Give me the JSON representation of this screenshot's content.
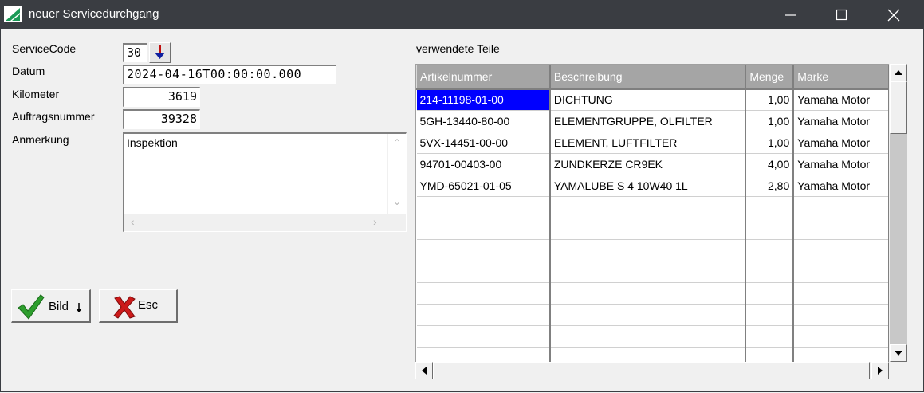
{
  "window": {
    "title": "neuer Servicedurchgang"
  },
  "form": {
    "servicecode_label": "ServiceCode",
    "servicecode_value": "30",
    "datum_label": "Datum",
    "datum_value": "2024-04-16T00:00:00.000",
    "kilometer_label": "Kilometer",
    "kilometer_value": "3619",
    "auftrag_label": "Auftragsnummer",
    "auftrag_value": "39328",
    "anmerkung_label": "Anmerkung",
    "anmerkung_value": "Inspektion"
  },
  "buttons": {
    "bild_label": "Bild",
    "esc_label": "Esc"
  },
  "grid": {
    "title": "verwendete Teile",
    "columns": [
      "Artikelnummer",
      "Beschreibung",
      "Menge",
      "Marke"
    ],
    "rows": [
      [
        "214-11198-01-00",
        "DICHTUNG",
        "1,00",
        "Yamaha Motor"
      ],
      [
        "5GH-13440-80-00",
        "ELEMENTGRUPPE, OLFILTER",
        "1,00",
        "Yamaha Motor"
      ],
      [
        "5VX-14451-00-00",
        "ELEMENT, LUFTFILTER",
        "1,00",
        "Yamaha Motor"
      ],
      [
        "94701-00403-00",
        "ZUNDKERZE CR9EK",
        "4,00",
        "Yamaha Motor"
      ],
      [
        "YMD-65021-01-05",
        "YAMALUBE S 4 10W40 1L",
        "2,80",
        "Yamaha Motor"
      ]
    ]
  },
  "icons": {
    "app": "app-icon",
    "minimize": "minimize-icon",
    "maximize": "maximize-icon",
    "close": "close-icon",
    "check": "check-icon",
    "x": "x-icon",
    "arrow": "arrow-down-icon"
  }
}
